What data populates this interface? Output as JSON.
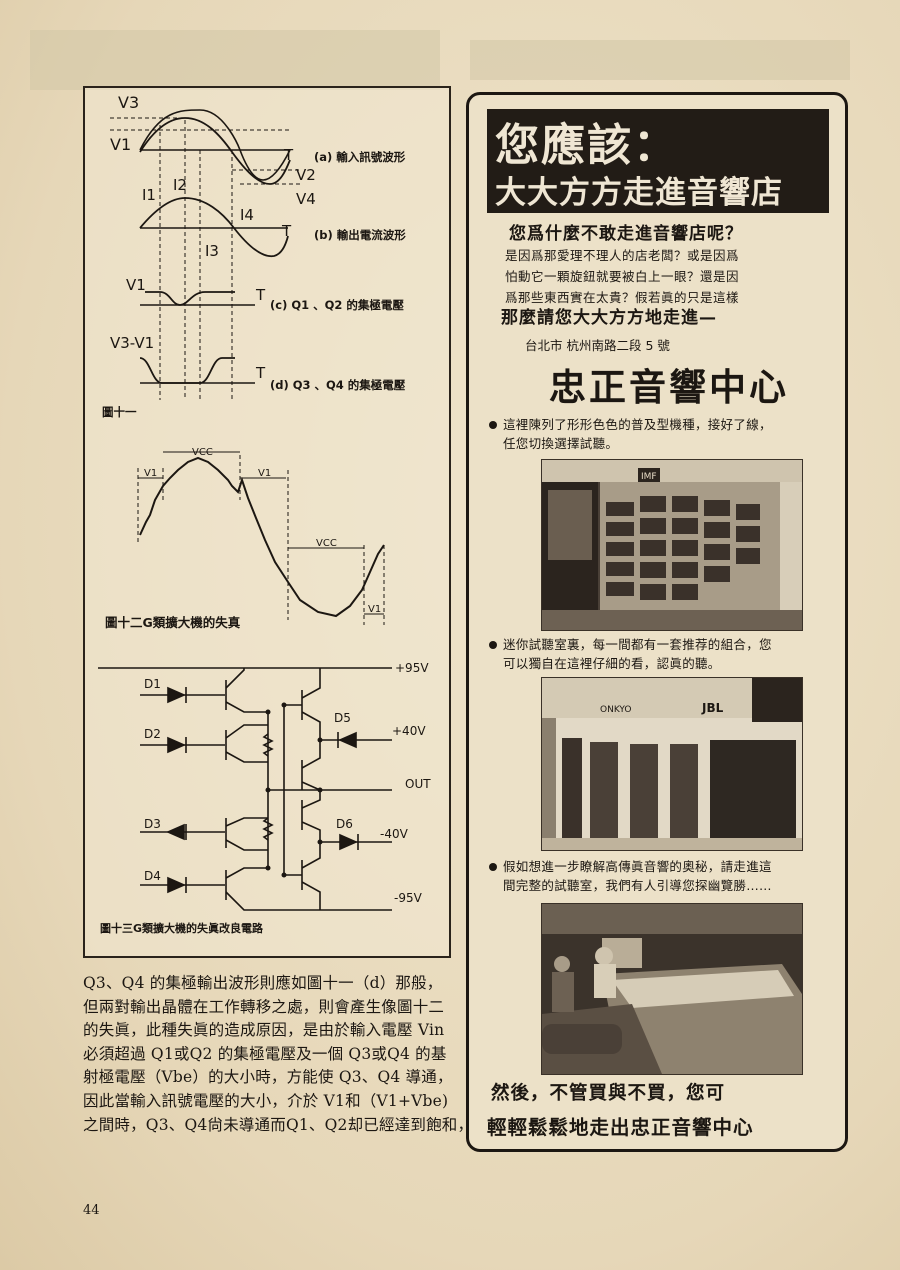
{
  "page": {
    "number": "44"
  },
  "figure11": {
    "waveform_labels": {
      "v3": "V3",
      "v1": "V1",
      "v2": "V2",
      "v4": "V4",
      "i1": "I1",
      "i2": "I2",
      "i3": "I3",
      "i4": "I4",
      "t": "T",
      "v1_c": "V1",
      "v3_minus_v1": "V3-V1"
    },
    "captions": {
      "a": "(a) 輸入訊號波形",
      "b": "(b) 輸出電流波形",
      "c": "(c) Q1 、Q2 的集極電壓",
      "d": "(d) Q3 、Q4 的集極電壓"
    },
    "title": "圖十一"
  },
  "figure12": {
    "labels": {
      "vcc_top": "VCC",
      "v1_left": "V1",
      "v1_right": "V1",
      "vcc_bottom": "VCC",
      "v1_bottom": "V1"
    },
    "title": "圖十二G類擴大機的失真"
  },
  "figure13": {
    "diodes": [
      "D1",
      "D2",
      "D3",
      "D4",
      "D5",
      "D6"
    ],
    "rails": [
      "+95V",
      "+40V",
      "OUT",
      "-40V",
      "-95V"
    ],
    "title": "圖十三G類擴大機的失眞改良電路"
  },
  "body_text": {
    "lines": [
      "Q3、Q4 的集極輸出波形則應如圖十一（d）那般，",
      "但兩對輸出晶體在工作轉移之處，則會產生像圖十二",
      "的失眞，此種失眞的造成原因，是由於輸入電壓 Vin",
      "必須超過 Q1或Q2 的集極電壓及一個 Q3或Q4 的基",
      "射極電壓（Vbe）的大小時，方能使 Q3、Q4 導通，",
      "因此當輸入訊號電壓的大小，介於 V1和（V1+Vbe)",
      "之間時，Q3、Q4尙未導通而Q1、Q2却已經達到飽和，"
    ]
  },
  "ad": {
    "headline": "您應該：",
    "subheadline": "大大方方走進音響店",
    "question": "您爲什麼不敢走進音響店呢？",
    "intro_lines": [
      "是因爲那愛理不理人的店老闆？或是因爲",
      "怕動它一顆旋鈕就要被白上一眼？還是因",
      "爲那些東西實在太貴？假若眞的只是這樣"
    ],
    "invite": "那麼請您大大方方地走進—",
    "address": "台北市 杭州南路二段 5 號",
    "store_name": "忠正音響中心",
    "bullets": [
      {
        "lines": [
          "這裡陳列了形形色色的普及型機種，接好了線，",
          "任您切換選擇試聽。"
        ]
      },
      {
        "lines": [
          "迷你試聽室裏，每一間都有一套推荐的組合，您",
          "可以獨自在這裡仔細的看，認眞的聽。"
        ]
      },
      {
        "lines": [
          "假如想進一步瞭解高傳眞音響的奧秘，請走進這",
          "間完整的試聽室，我們有人引導您探幽覽勝……"
        ]
      }
    ],
    "photo2_brands": [
      "ONKYO",
      "JBL"
    ],
    "photo1_brand": "IMF",
    "closing_line1": "然後，不管買與不買，您可",
    "closing_line2": "輕輕鬆鬆地走出忠正音響中心"
  }
}
